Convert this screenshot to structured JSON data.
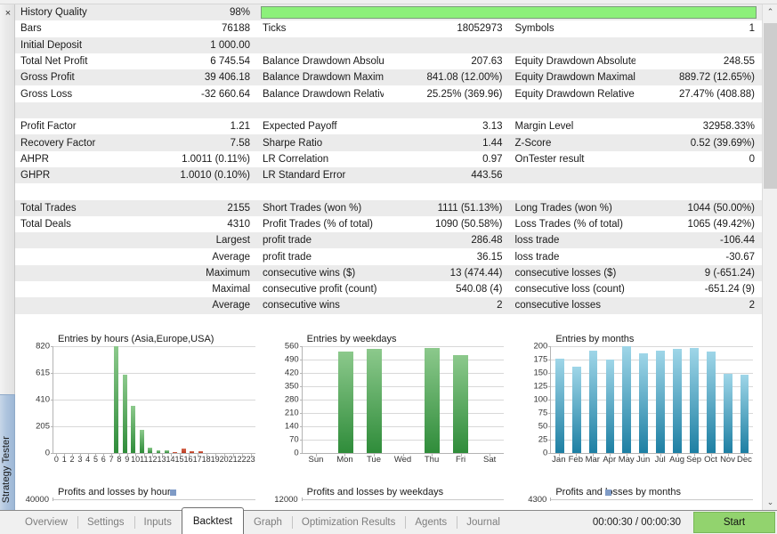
{
  "window": {
    "panel_title": "Strategy Tester",
    "close_icon": "×"
  },
  "progress": {
    "percent": 100,
    "color": "#8cf07a"
  },
  "stats": {
    "col1": [
      {
        "label": "History Quality",
        "value": "98%"
      },
      {
        "label": "Bars",
        "value": "76188"
      },
      {
        "label": "Initial Deposit",
        "value": "1 000.00"
      },
      {
        "label": "Total Net Profit",
        "value": "6 745.54"
      },
      {
        "label": "Gross Profit",
        "value": "39 406.18"
      },
      {
        "label": "Gross Loss",
        "value": "-32 660.64"
      },
      {
        "label": "",
        "value": ""
      },
      {
        "label": "Profit Factor",
        "value": "1.21"
      },
      {
        "label": "Recovery Factor",
        "value": "7.58"
      },
      {
        "label": "AHPR",
        "value": "1.0011 (0.11%)"
      },
      {
        "label": "GHPR",
        "value": "1.0010 (0.10%)"
      },
      {
        "label": "",
        "value": ""
      },
      {
        "label": "Total Trades",
        "value": "2155"
      },
      {
        "label": "Total Deals",
        "value": "4310"
      },
      {
        "label": "",
        "value": "Largest"
      },
      {
        "label": "",
        "value": "Average"
      },
      {
        "label": "",
        "value": "Maximum"
      },
      {
        "label": "",
        "value": "Maximal"
      },
      {
        "label": "",
        "value": "Average"
      }
    ],
    "col2": [
      {
        "label": "",
        "value": ""
      },
      {
        "label": "Ticks",
        "value": "18052973"
      },
      {
        "label": "",
        "value": ""
      },
      {
        "label": "Balance Drawdown Absolute",
        "value": "207.63"
      },
      {
        "label": "Balance Drawdown Maximal",
        "value": "841.08 (12.00%)"
      },
      {
        "label": "Balance Drawdown Relative",
        "value": "25.25% (369.96)"
      },
      {
        "label": "",
        "value": ""
      },
      {
        "label": "Expected Payoff",
        "value": "3.13"
      },
      {
        "label": "Sharpe Ratio",
        "value": "1.44"
      },
      {
        "label": "LR Correlation",
        "value": "0.97"
      },
      {
        "label": "LR Standard Error",
        "value": "443.56"
      },
      {
        "label": "",
        "value": ""
      },
      {
        "label": "Short Trades (won %)",
        "value": "1111 (51.13%)"
      },
      {
        "label": "Profit Trades (% of total)",
        "value": "1090 (50.58%)"
      },
      {
        "label": "profit trade",
        "value": "286.48"
      },
      {
        "label": "profit trade",
        "value": "36.15"
      },
      {
        "label": "consecutive wins ($)",
        "value": "13 (474.44)"
      },
      {
        "label": "consecutive profit (count)",
        "value": "540.08 (4)"
      },
      {
        "label": "consecutive wins",
        "value": "2"
      }
    ],
    "col3": [
      {
        "label": "",
        "value": ""
      },
      {
        "label": "Symbols",
        "value": "1"
      },
      {
        "label": "",
        "value": ""
      },
      {
        "label": "Equity Drawdown Absolute",
        "value": "248.55"
      },
      {
        "label": "Equity Drawdown Maximal",
        "value": "889.72 (12.65%)"
      },
      {
        "label": "Equity Drawdown Relative",
        "value": "27.47% (408.88)"
      },
      {
        "label": "",
        "value": ""
      },
      {
        "label": "Margin Level",
        "value": "32958.33%"
      },
      {
        "label": "Z-Score",
        "value": "0.52 (39.69%)"
      },
      {
        "label": "OnTester result",
        "value": "0"
      },
      {
        "label": "",
        "value": ""
      },
      {
        "label": "",
        "value": ""
      },
      {
        "label": "Long Trades (won %)",
        "value": "1044 (50.00%)"
      },
      {
        "label": "Loss Trades (% of total)",
        "value": "1065 (49.42%)"
      },
      {
        "label": "loss trade",
        "value": "-106.44"
      },
      {
        "label": "loss trade",
        "value": "-30.67"
      },
      {
        "label": "consecutive losses ($)",
        "value": "9 (-651.24)"
      },
      {
        "label": "consecutive loss (count)",
        "value": "-651.24 (9)"
      },
      {
        "label": "consecutive losses",
        "value": "2"
      }
    ]
  },
  "chart_data": [
    {
      "type": "bar",
      "title": "Entries by hours (Asia,Europe,USA)",
      "xlabel": "",
      "ylabel": "",
      "ylim": [
        0,
        820
      ],
      "yticks": [
        0,
        205,
        410,
        615,
        820
      ],
      "grid": true,
      "categories": [
        "0",
        "1",
        "2",
        "3",
        "4",
        "5",
        "6",
        "7",
        "8",
        "9",
        "10",
        "11",
        "12",
        "13",
        "14",
        "15",
        "16",
        "17",
        "18",
        "19",
        "20",
        "21",
        "22",
        "23"
      ],
      "values": [
        0,
        0,
        0,
        0,
        0,
        0,
        0,
        820,
        600,
        363,
        180,
        42,
        22,
        20,
        10,
        33,
        14,
        12,
        3,
        1,
        0,
        0,
        0,
        0
      ],
      "colors": [
        "green",
        "green",
        "green",
        "green",
        "green",
        "green",
        "green",
        "green",
        "green",
        "green",
        "green",
        "green",
        "green",
        "green",
        "red",
        "red",
        "red",
        "red",
        "red",
        "red",
        "green",
        "green",
        "green",
        "green"
      ]
    },
    {
      "type": "bar",
      "title": "Entries by weekdays",
      "xlabel": "",
      "ylabel": "",
      "ylim": [
        0,
        560
      ],
      "yticks": [
        0,
        70,
        140,
        210,
        280,
        350,
        420,
        490,
        560
      ],
      "grid": true,
      "categories": [
        "Sun",
        "Mon",
        "Tue",
        "Wed",
        "Thu",
        "Fri",
        "Sat"
      ],
      "values": [
        0,
        532,
        548,
        0,
        549,
        513,
        0
      ],
      "colors": [
        "green",
        "green",
        "green",
        "green",
        "green",
        "green",
        "green"
      ]
    },
    {
      "type": "bar",
      "title": "Entries by months",
      "xlabel": "",
      "ylabel": "",
      "ylim": [
        0,
        200
      ],
      "yticks": [
        0,
        25,
        50,
        75,
        100,
        125,
        150,
        175,
        200
      ],
      "grid": true,
      "categories": [
        "Jan",
        "Feb",
        "Mar",
        "Apr",
        "May",
        "Jun",
        "Jul",
        "Aug",
        "Sep",
        "Oct",
        "Nov",
        "Dec"
      ],
      "values": [
        176,
        162,
        191,
        175,
        200,
        186,
        191,
        195,
        196,
        190,
        149,
        147
      ],
      "colors": [
        "blue",
        "blue",
        "blue",
        "blue",
        "blue",
        "blue",
        "blue",
        "blue",
        "blue",
        "blue",
        "blue",
        "blue"
      ]
    }
  ],
  "charts_bottom": [
    {
      "title": "Profits and losses by hours",
      "ytop": "40000"
    },
    {
      "title": "Profits and losses by weekdays",
      "ytop": "12000"
    },
    {
      "title": "Profits and losses by months",
      "ytop": "4300"
    }
  ],
  "scrollbar": {
    "up_icon": "⌃",
    "down_icon": "⌄"
  },
  "tabs": [
    {
      "label": "Overview",
      "active": false
    },
    {
      "label": "Settings",
      "active": false
    },
    {
      "label": "Inputs",
      "active": false
    },
    {
      "label": "Backtest",
      "active": true
    },
    {
      "label": "Graph",
      "active": false
    },
    {
      "label": "Optimization Results",
      "active": false
    },
    {
      "label": "Agents",
      "active": false
    },
    {
      "label": "Journal",
      "active": false
    }
  ],
  "footer": {
    "timer": "00:00:30 / 00:00:30",
    "start_label": "Start",
    "start_color": "#92d36e"
  }
}
